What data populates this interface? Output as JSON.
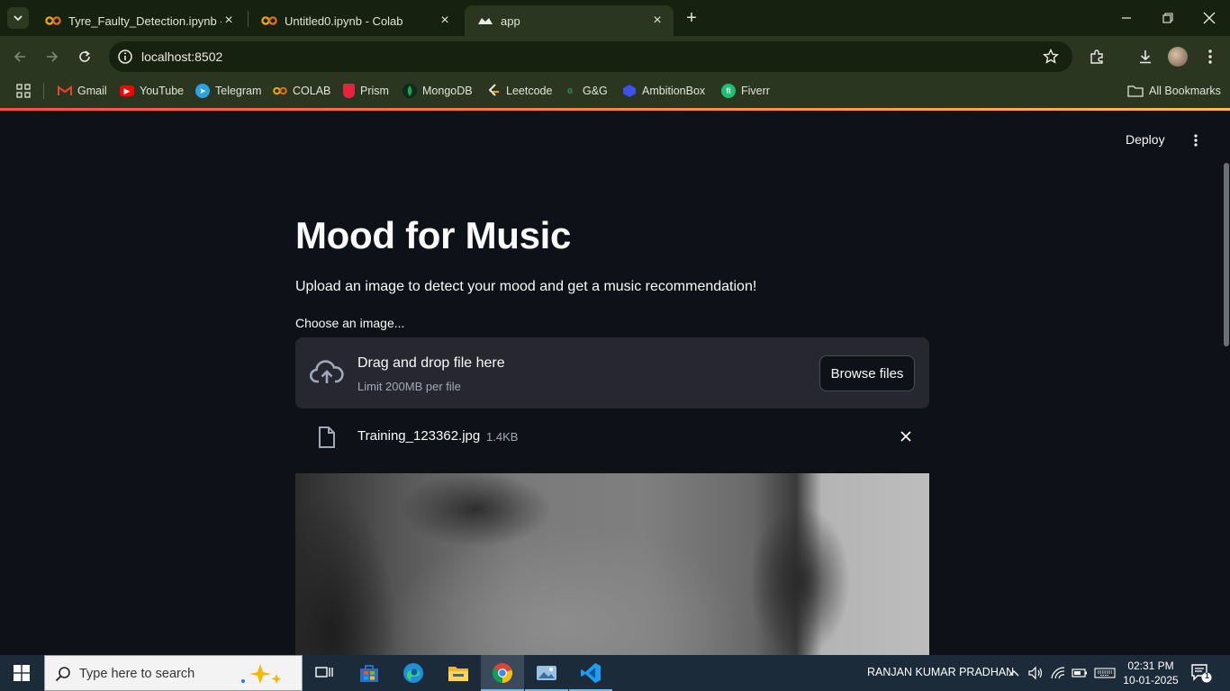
{
  "browser": {
    "tabs": [
      {
        "label": "Tyre_Faulty_Detection.ipynb - C",
        "favicon": "colab-icon",
        "active": false
      },
      {
        "label": "Untitled0.ipynb - Colab",
        "favicon": "colab-icon",
        "active": false
      },
      {
        "label": "app",
        "favicon": "streamlit-icon",
        "active": true
      }
    ],
    "url": "localhost:8502",
    "bookmarks": [
      {
        "label": "Gmail",
        "icon": "gmail-icon",
        "color": "#ea4335"
      },
      {
        "label": "YouTube",
        "icon": "youtube-icon",
        "color": "#ff0000"
      },
      {
        "label": "Telegram",
        "icon": "telegram-icon",
        "color": "#2aa3e0"
      },
      {
        "label": "COLAB",
        "icon": "colab-icon",
        "color": "#f9ab00"
      },
      {
        "label": "Prism",
        "icon": "prism-icon",
        "color": "#e5243b"
      },
      {
        "label": "MongoDB",
        "icon": "mongodb-icon",
        "color": "#13aa52"
      },
      {
        "label": "Leetcode",
        "icon": "leetcode-icon",
        "color": "#ffa116"
      },
      {
        "label": "G&G",
        "icon": "gfg-icon",
        "color": "#2f8d46"
      },
      {
        "label": "AmbitionBox",
        "icon": "ambitionbox-icon",
        "color": "#3f51e6"
      },
      {
        "label": "Fiverr",
        "icon": "fiverr-icon",
        "color": "#1dbf73"
      }
    ],
    "all_bookmarks": "All Bookmarks"
  },
  "app": {
    "deploy_label": "Deploy",
    "title": "Mood for Music",
    "subtitle": "Upload an image to detect your mood and get a music recommendation!",
    "uploader": {
      "label": "Choose an image...",
      "drag_text": "Drag and drop file here",
      "limit_text": "Limit 200MB per file",
      "browse_label": "Browse files"
    },
    "file": {
      "name": "Training_123362.jpg",
      "size": "1.4KB"
    }
  },
  "taskbar": {
    "search_placeholder": "Type here to search",
    "user": "RANJAN KUMAR PRADHAN",
    "time": "02:31 PM",
    "date": "10-01-2025",
    "notification_count": "1"
  },
  "colors": {
    "streamlit_bg": "#0e1117",
    "dropzone_bg": "#262730",
    "browser_frame": "#2b3620",
    "accent_line_start": "#ff4b4b",
    "accent_line_end": "#ffbd45"
  }
}
